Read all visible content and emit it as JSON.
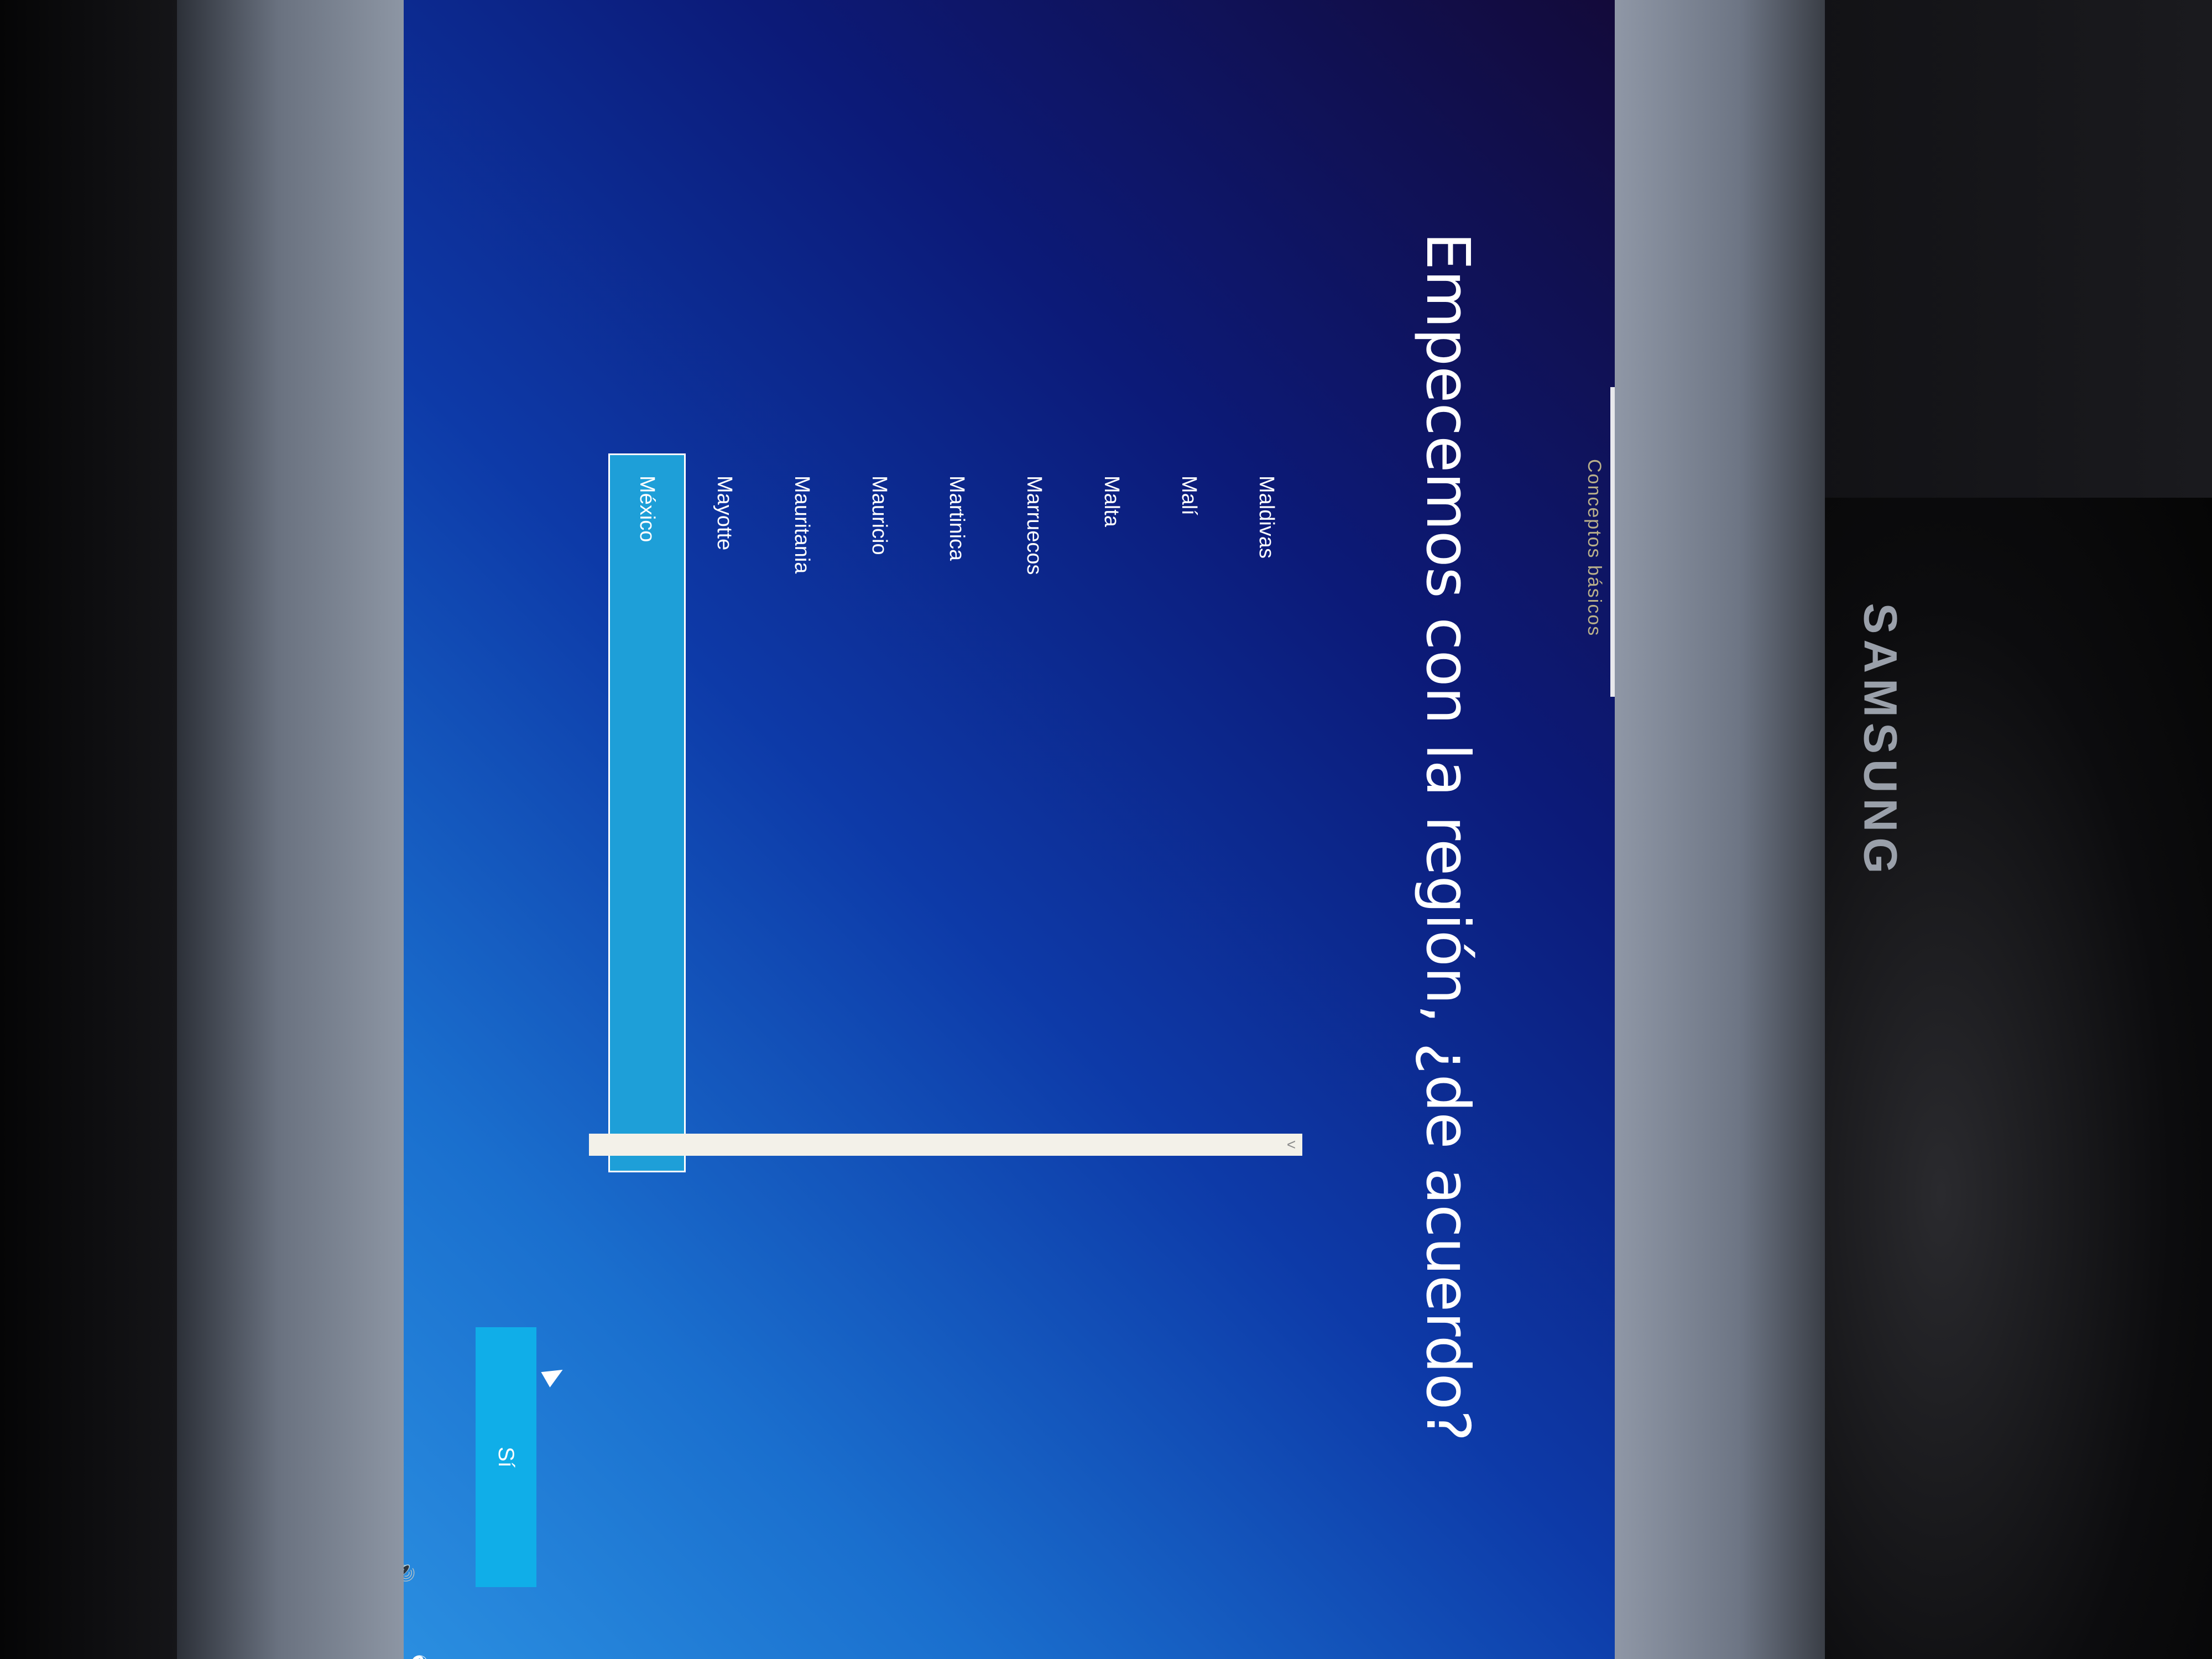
{
  "screen": {
    "step_label": "Conceptos básicos",
    "title": "Empecemos con la región, ¿de acuerdo?",
    "regions": [
      "Maldivas",
      "Malí",
      "Malta",
      "Marruecos",
      "Martinica",
      "Mauricio",
      "Mauritania",
      "Mayotte",
      "México"
    ],
    "selected_region": "México",
    "yes_button_label": "Sí",
    "scroll_arrow": "<"
  },
  "monitor": {
    "brand": "SAMSUNG"
  },
  "icons": {
    "volume": "volume-icon",
    "accessibility": "ease-of-access-icon"
  },
  "colors": {
    "background_dark": "#0c1a78",
    "background_light": "#2a8ee0",
    "selected_item": "#1e9fd8",
    "button": "#10aee8"
  }
}
